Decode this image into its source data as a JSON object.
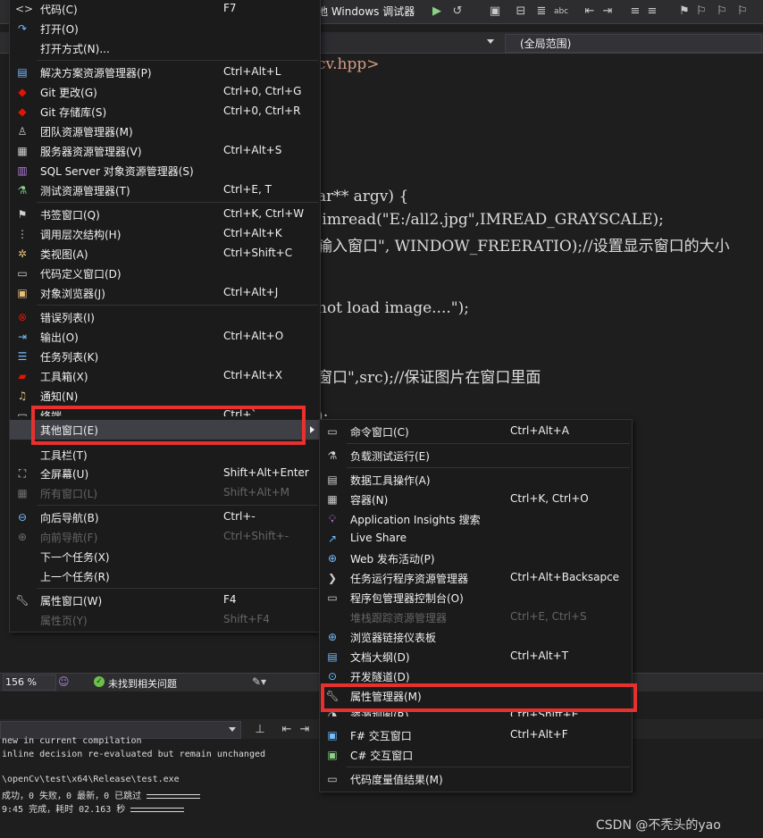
{
  "toolbar": {
    "debugger_label": "地 Windows 调试器"
  },
  "editor": {
    "scope": "(全局范围)",
    "lines": [
      {
        "text": "cv.hpp>"
      },
      {
        "text": "ar** argv) {"
      },
      {
        "text": " imread(\"E:/all2.jpg\",IMREAD_GRAYSCALE);"
      },
      {
        "text": "输入窗口\", WINDOW_FREERATIO);//设置显示窗口的大小"
      },
      {
        "text": "not load image....\");"
      },
      {
        "text": "窗口\",src);//保证图片在窗口里面"
      },
      {
        "text": ");"
      }
    ]
  },
  "status": {
    "zoom": "156 %",
    "issues": "未找到相关问题"
  },
  "output": {
    "lines": [
      "new in current compilation",
      "inline decision re-evaluated but remain unchanged",
      "",
      "\\openCv\\test\\x64\\Release\\test.exe",
      "成功，0 失败，0 最新，0 已跳过",
      "9:45 完成，耗时 02.163 秒"
    ]
  },
  "watermark": "CSDN @不秃头的yao",
  "main_menu": {
    "items": [
      {
        "label": "代码(C)",
        "shortcut": "F7",
        "icon": "code-icon"
      },
      {
        "label": "打开(O)",
        "shortcut": "",
        "icon": "open-icon"
      },
      {
        "label": "打开方式(N)...",
        "shortcut": "",
        "icon": ""
      },
      {
        "label": "解决方案资源管理器(P)",
        "shortcut": "Ctrl+Alt+L",
        "icon": "solution-explorer-icon"
      },
      {
        "label": "Git 更改(G)",
        "shortcut": "Ctrl+0, Ctrl+G",
        "icon": "git-changes-icon"
      },
      {
        "label": "Git 存储库(S)",
        "shortcut": "Ctrl+0, Ctrl+R",
        "icon": "git-repo-icon"
      },
      {
        "label": "团队资源管理器(M)",
        "shortcut": "",
        "icon": "team-explorer-icon"
      },
      {
        "label": "服务器资源管理器(V)",
        "shortcut": "Ctrl+Alt+S",
        "icon": "server-explorer-icon"
      },
      {
        "label": "SQL Server 对象资源管理器(S)",
        "shortcut": "",
        "icon": "sql-server-icon"
      },
      {
        "label": "测试资源管理器(T)",
        "shortcut": "Ctrl+E, T",
        "icon": "test-explorer-icon"
      },
      {
        "label": "书签窗口(Q)",
        "shortcut": "Ctrl+K, Ctrl+W",
        "icon": "bookmark-icon"
      },
      {
        "label": "调用层次结构(H)",
        "shortcut": "Ctrl+Alt+K",
        "icon": "call-hierarchy-icon"
      },
      {
        "label": "类视图(A)",
        "shortcut": "Ctrl+Shift+C",
        "icon": "class-view-icon"
      },
      {
        "label": "代码定义窗口(D)",
        "shortcut": "",
        "icon": "code-definition-icon"
      },
      {
        "label": "对象浏览器(J)",
        "shortcut": "Ctrl+Alt+J",
        "icon": "object-browser-icon"
      },
      {
        "label": "错误列表(I)",
        "shortcut": "",
        "icon": "error-list-icon"
      },
      {
        "label": "输出(O)",
        "shortcut": "Ctrl+Alt+O",
        "icon": "output-icon"
      },
      {
        "label": "任务列表(K)",
        "shortcut": "",
        "icon": "task-list-icon"
      },
      {
        "label": "工具箱(X)",
        "shortcut": "Ctrl+Alt+X",
        "icon": "toolbox-icon"
      },
      {
        "label": "通知(N)",
        "shortcut": "",
        "icon": "notification-icon"
      },
      {
        "label": "终端",
        "shortcut": "Ctrl+`",
        "icon": "terminal-icon"
      },
      {
        "label": "其他窗口(E)",
        "shortcut": "",
        "icon": ""
      },
      {
        "label": "工具栏(T)",
        "shortcut": "",
        "icon": ""
      },
      {
        "label": "全屏幕(U)",
        "shortcut": "Shift+Alt+Enter",
        "icon": "fullscreen-icon"
      },
      {
        "label": "所有窗口(L)",
        "shortcut": "Shift+Alt+M",
        "icon": "all-windows-icon"
      },
      {
        "label": "向后导航(B)",
        "shortcut": "Ctrl+-",
        "icon": "navigate-back-icon"
      },
      {
        "label": "向前导航(F)",
        "shortcut": "Ctrl+Shift+-",
        "icon": "navigate-forward-icon"
      },
      {
        "label": "下一个任务(X)",
        "shortcut": "",
        "icon": ""
      },
      {
        "label": "上一个任务(R)",
        "shortcut": "",
        "icon": ""
      },
      {
        "label": "属性窗口(W)",
        "shortcut": "F4",
        "icon": "wrench-icon"
      },
      {
        "label": "属性页(Y)",
        "shortcut": "Shift+F4",
        "icon": ""
      }
    ]
  },
  "sub_menu": {
    "items": [
      {
        "label": "命令窗口(C)",
        "shortcut": "Ctrl+Alt+A",
        "icon": "command-window-icon"
      },
      {
        "label": "负载测试运行(E)",
        "shortcut": "",
        "icon": "load-test-icon"
      },
      {
        "label": "数据工具操作(A)",
        "shortcut": "",
        "icon": "data-tools-icon"
      },
      {
        "label": "容器(N)",
        "shortcut": "Ctrl+K, Ctrl+O",
        "icon": "containers-icon"
      },
      {
        "label": "Application Insights 搜索",
        "shortcut": "",
        "icon": "app-insights-icon"
      },
      {
        "label": "Live Share",
        "shortcut": "",
        "icon": "live-share-icon"
      },
      {
        "label": "Web 发布活动(P)",
        "shortcut": "",
        "icon": "web-publish-icon"
      },
      {
        "label": "任务运行程序资源管理器",
        "shortcut": "Ctrl+Alt+Backsapce",
        "icon": "task-runner-icon"
      },
      {
        "label": "程序包管理器控制台(O)",
        "shortcut": "",
        "icon": "package-console-icon"
      },
      {
        "label": "堆栈跟踪资源管理器",
        "shortcut": "Ctrl+E, Ctrl+S",
        "icon": "stack-trace-icon"
      },
      {
        "label": "浏览器链接仪表板",
        "shortcut": "",
        "icon": "browser-link-icon"
      },
      {
        "label": "文档大纲(D)",
        "shortcut": "Ctrl+Alt+T",
        "icon": "document-outline-icon"
      },
      {
        "label": "开发隧道(D)",
        "shortcut": "",
        "icon": "dev-tunnels-icon"
      },
      {
        "label": "属性管理器(M)",
        "shortcut": "",
        "icon": "property-manager-icon"
      },
      {
        "label": "资源视图(R)",
        "shortcut": "Ctrl+Shift+E",
        "icon": "resource-view-icon"
      },
      {
        "label": "F# 交互窗口",
        "shortcut": "Ctrl+Alt+F",
        "icon": "fsharp-interactive-icon"
      },
      {
        "label": "C# 交互窗口",
        "shortcut": "",
        "icon": "csharp-interactive-icon"
      },
      {
        "label": "代码度量值结果(M)",
        "shortcut": "",
        "icon": "code-metrics-icon"
      }
    ]
  }
}
